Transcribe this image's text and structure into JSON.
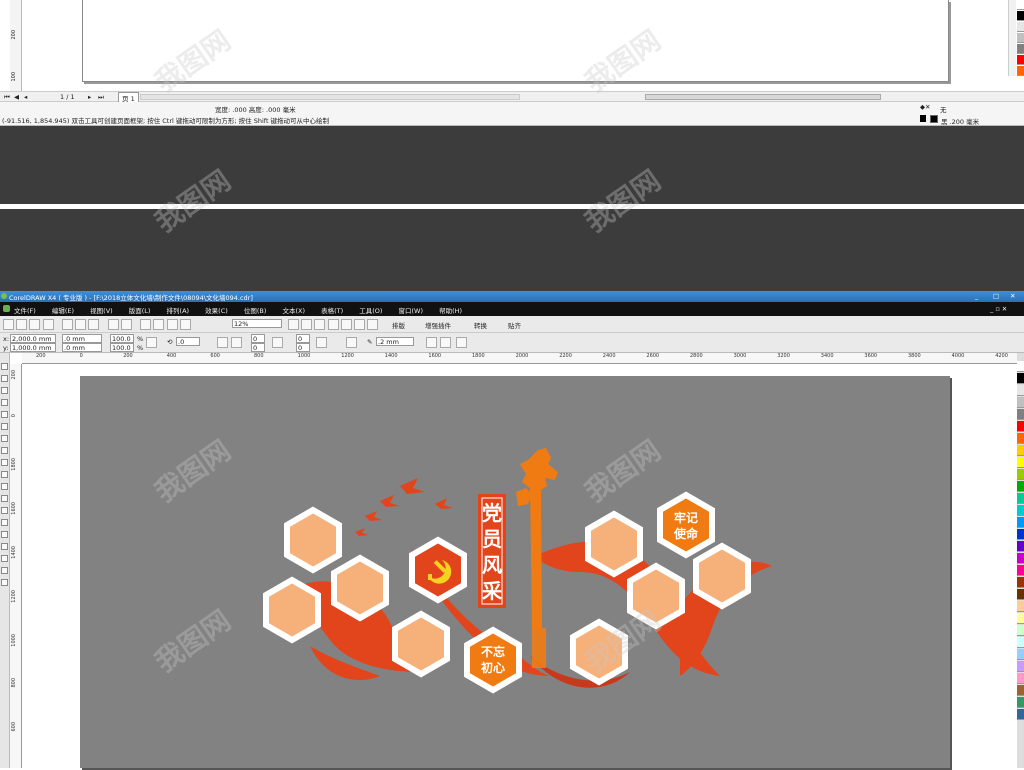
{
  "previous_window": {
    "page_nav": {
      "counter": "1 / 1",
      "page_tab": "页 1"
    },
    "status": {
      "dims_text": "宽度: .000  高度: .000 毫米",
      "fill_label": "无",
      "outline_label": "黑 .200 毫米",
      "hint_text": "(-91.516, 1,854.945) 双击工具可创建页面框架; 按住 Ctrl 键拖动可限制为方形; 按住 Shift 键拖动可从中心绘制"
    },
    "ruler_ticks": [
      "200",
      "100"
    ]
  },
  "window": {
    "title": "CorelDRAW X4 ( 专业版 ) - [F:\\2018立体文化墙\\制作文件\\08094\\文化墙094.cdr]",
    "controls": [
      "_",
      "□",
      "✕"
    ]
  },
  "menu": [
    "文件(F)",
    "编辑(E)",
    "视图(V)",
    "版面(L)",
    "排列(A)",
    "效果(C)",
    "位图(B)",
    "文本(X)",
    "表格(T)",
    "工具(O)",
    "窗口(W)",
    "帮助(H)"
  ],
  "toolbar": {
    "zoom": "12%",
    "buttons": [
      "排版",
      "增强插件",
      "转换",
      "贴齐"
    ]
  },
  "propbar": {
    "x": "2,000.0 mm",
    "y": "1,000.0 mm",
    "w": ".0 mm",
    "h": ".0 mm",
    "scale_w": "100.0",
    "scale_h": "100.0",
    "pct": "%",
    "rotation": ".0",
    "corner_a": "0",
    "corner_b": "0",
    "corner_c": "0",
    "corner_d": "0",
    "outline": ".2 mm"
  },
  "hruler_ticks": [
    "200",
    "0",
    "200",
    "400",
    "600",
    "800",
    "1000",
    "1200",
    "1400",
    "1600",
    "1800",
    "2000",
    "2200",
    "2400",
    "2600",
    "2800",
    "3000",
    "3200",
    "3400",
    "3600",
    "3800",
    "4000",
    "4200"
  ],
  "vruler_ticks": [
    "200",
    "0",
    "1800",
    "1600",
    "1400",
    "1200",
    "1000",
    "800",
    "600"
  ],
  "artwork": {
    "title_chars": [
      "党",
      "员",
      "风",
      "采"
    ],
    "badge_top": "牢记\n使命",
    "badge_bottom": "不忘\n初心",
    "colors": {
      "orange": "#f07b12",
      "red": "#e2451b",
      "peach": "#f6b07a",
      "canvas": "#828282",
      "emblem_yellow": "#f7d21e"
    }
  },
  "watermark": "我图网",
  "palette_colors": [
    "#ffffff",
    "#000000",
    "#e6e6e6",
    "#c0c0c0",
    "#808080",
    "#ff0000",
    "#ff6600",
    "#ffcc00",
    "#ffff00",
    "#99cc00",
    "#00aa00",
    "#00cc99",
    "#00cccc",
    "#0099ff",
    "#0033cc",
    "#6600cc",
    "#cc00cc",
    "#ff0099",
    "#993300",
    "#663300",
    "#ffcc99",
    "#ffff99",
    "#ccffcc",
    "#ccffff",
    "#99ccff",
    "#cc99ff",
    "#ff99cc",
    "#996633",
    "#339966",
    "#336699"
  ]
}
